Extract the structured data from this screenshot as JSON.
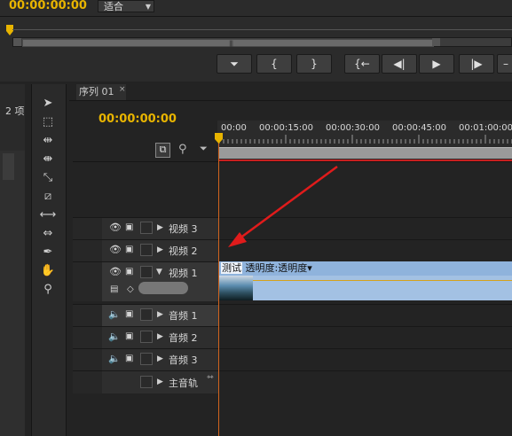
{
  "monitor": {
    "timecode": "00:00:00:00",
    "fit_select": "适合",
    "transport_buttons": [
      {
        "name": "mark-in-icon",
        "glyph": "⏷"
      },
      {
        "name": "set-in-point-icon",
        "glyph": "{"
      },
      {
        "name": "set-out-point-icon",
        "glyph": "}"
      },
      {
        "name": "go-to-in-icon",
        "glyph": "{←"
      },
      {
        "name": "step-back-icon",
        "glyph": "◀|"
      },
      {
        "name": "play-icon",
        "glyph": "▶"
      },
      {
        "name": "step-forward-icon",
        "glyph": "|▶"
      },
      {
        "name": "more-icon",
        "glyph": "–"
      }
    ]
  },
  "project": {
    "count_label": "2 项"
  },
  "sequence": {
    "tab_label": "序列 01",
    "tab_close": "×",
    "timecode": "00:00:00:00",
    "ruler_labels": [
      "00:00",
      "00:00:15:00",
      "00:00:30:00",
      "00:00:45:00",
      "00:01:00:00"
    ]
  },
  "tracks": {
    "video3": "视频 3",
    "video2": "视频 2",
    "video1": "视频 1",
    "audio1": "音频 1",
    "audio2": "音频 2",
    "audio3": "音频 3",
    "master": "主音轨"
  },
  "clip": {
    "name": "测试",
    "effect_menu": "透明度:透明度"
  },
  "colors": {
    "timecode": "#e8b400",
    "clip_video": "#8fb3dc",
    "playhead": "#d2641e",
    "annotation_arrow": "#e01b1b"
  }
}
